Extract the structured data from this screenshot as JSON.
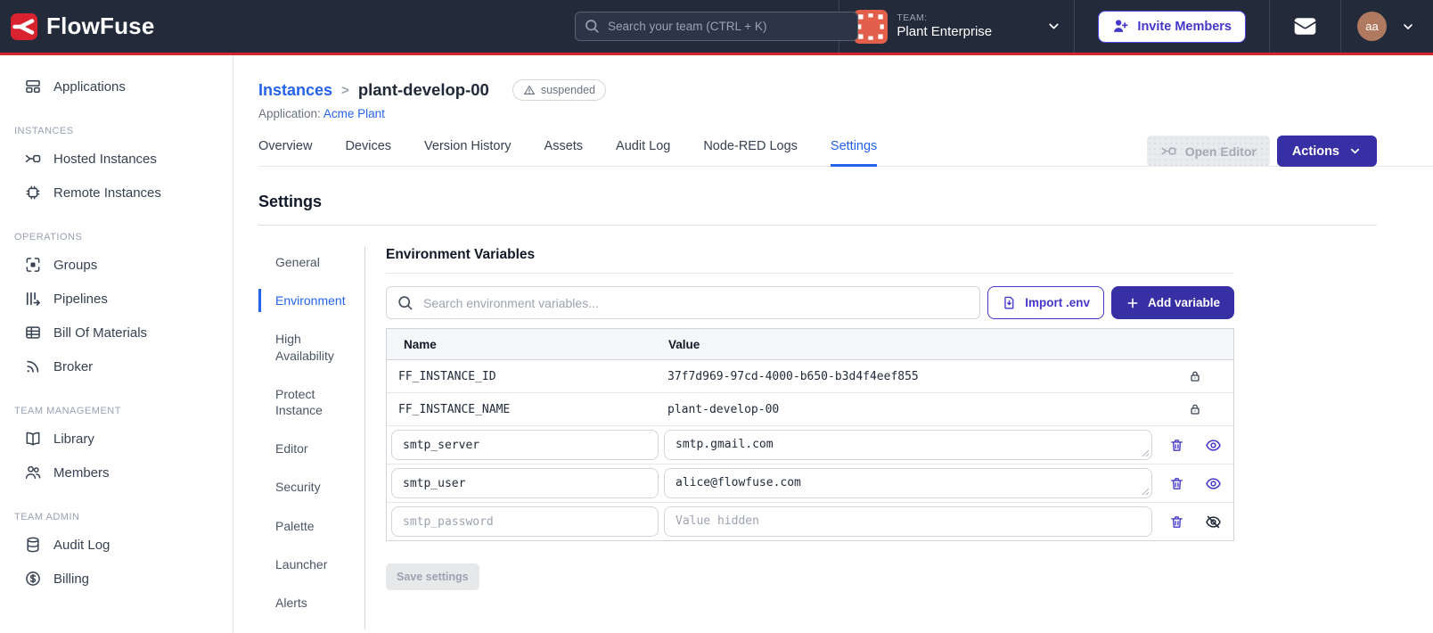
{
  "colors": {
    "navbar_bg": "#232B3B",
    "brand_red": "#D8222F",
    "accent_blue": "#2563EB",
    "indigo_button": "#372FA4",
    "indigo_outline": "#4338CA",
    "avatar_brown": "#AF7A60",
    "team_avatar_orange": "#E2604B"
  },
  "navbar": {
    "brand": "FlowFuse",
    "search_placeholder": "Search your team (CTRL + K)",
    "team_label": "TEAM:",
    "team_name": "Plant Enterprise",
    "invite_button": "Invite Members",
    "avatar_initials": "aa"
  },
  "sidebar": {
    "applications": "Applications",
    "instances_header": "INSTANCES",
    "hosted": "Hosted Instances",
    "remote": "Remote Instances",
    "operations_header": "OPERATIONS",
    "groups": "Groups",
    "pipelines": "Pipelines",
    "bom": "Bill Of Materials",
    "broker": "Broker",
    "team_mgmt_header": "TEAM MANAGEMENT",
    "library": "Library",
    "members": "Members",
    "team_admin_header": "TEAM ADMIN",
    "audit": "Audit Log",
    "billing": "Billing"
  },
  "page": {
    "breadcrumb_parent": "Instances",
    "breadcrumb_separator": ">",
    "instance_name": "plant-develop-00",
    "status_badge": "suspended",
    "application_label": "Application:",
    "application_name": "Acme Plant",
    "open_editor_button": "Open Editor",
    "actions_button": "Actions"
  },
  "tabs": {
    "items": [
      {
        "label": "Overview"
      },
      {
        "label": "Devices"
      },
      {
        "label": "Version History"
      },
      {
        "label": "Assets"
      },
      {
        "label": "Audit Log"
      },
      {
        "label": "Node-RED Logs"
      },
      {
        "label": "Settings"
      }
    ],
    "active": "Settings"
  },
  "settings": {
    "title": "Settings",
    "nav": [
      {
        "label": "General"
      },
      {
        "label": "Environment"
      },
      {
        "label": "High Availability"
      },
      {
        "label": "Protect Instance"
      },
      {
        "label": "Editor"
      },
      {
        "label": "Security"
      },
      {
        "label": "Palette"
      },
      {
        "label": "Launcher"
      },
      {
        "label": "Alerts"
      }
    ],
    "active": "Environment"
  },
  "env": {
    "title": "Environment Variables",
    "search_placeholder": "Search environment variables...",
    "import_button": "Import .env",
    "add_button": "Add variable",
    "table": {
      "headers": {
        "name": "Name",
        "value": "Value"
      },
      "locked_rows": [
        {
          "name": "FF_INSTANCE_ID",
          "value": "37f7d969-97cd-4000-b650-b3d4f4eef855"
        },
        {
          "name": "FF_INSTANCE_NAME",
          "value": "plant-develop-00"
        }
      ],
      "editable_rows": [
        {
          "name": "smtp_server",
          "value": "smtp.gmail.com",
          "hidden": false
        },
        {
          "name": "smtp_user",
          "value": "alice@flowfuse.com",
          "hidden": false
        },
        {
          "name": "smtp_password",
          "value": "",
          "value_placeholder": "Value hidden",
          "hidden": true
        }
      ]
    },
    "save_button": "Save settings"
  }
}
